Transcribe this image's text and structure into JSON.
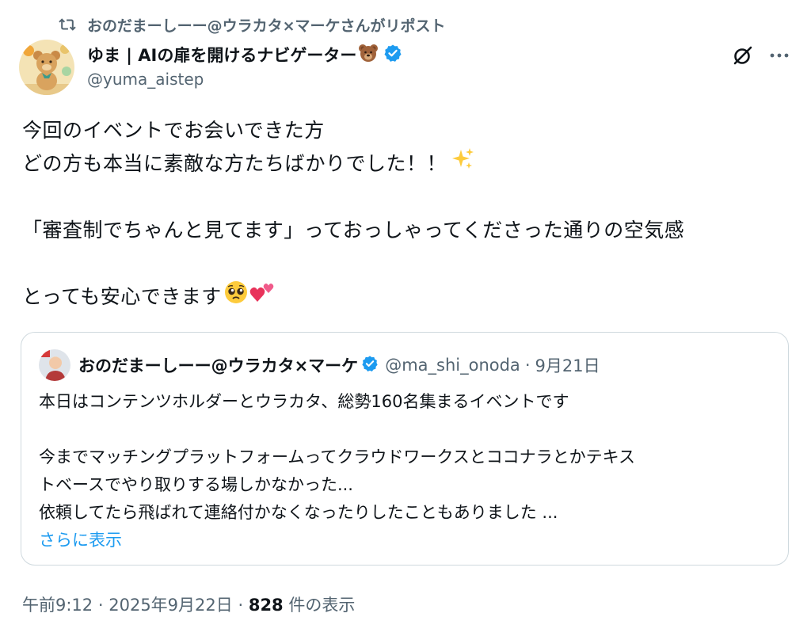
{
  "repost": {
    "text": "おのだまーしーー@ウラカタ×マーケさんがリポスト"
  },
  "author": {
    "name": "ゆま | AIの扉を開けるナビゲーター",
    "name_emoji": "bear-face-emoji",
    "verified": true,
    "handle": "@yuma_aistep"
  },
  "tweet": {
    "lines": [
      "今回のイベントでお会いできた方",
      "どの方も本当に素敵な方たちばかりでした！！",
      "",
      "「審査制でちゃんと見てます」っておっしゃってくださった通りの空気感",
      "",
      "とっても安心できます"
    ],
    "emojis": [
      "sparkles-emoji",
      "pleading-face-emoji",
      "two-hearts-emoji"
    ]
  },
  "quote": {
    "name": "おのだまーしーー@ウラカタ×マーケ",
    "verified": true,
    "handle": "@ma_shi_onoda",
    "separator": "·",
    "date": "9月21日",
    "lines": [
      "本日はコンテンツホルダーとウラカタ、総勢160名集まるイベントです",
      "",
      "今までマッチングプラットフォームってクラウドワークスとココナラとかテキス",
      "トベースでやり取りする場しかなかった...",
      "依頼してたら飛ばれて連絡付かなくなったりしたこともありました ..."
    ],
    "show_more": "さらに表示"
  },
  "meta": {
    "time": "午前9:12",
    "separator": "·",
    "date": "2025年9月22日",
    "views_count": "828",
    "views_label": "件の表示"
  },
  "colors": {
    "text": "#0f1419",
    "secondary": "#536471",
    "link": "#1d9bf0",
    "verified": "#1d9bf0",
    "border": "#cfd9de"
  }
}
